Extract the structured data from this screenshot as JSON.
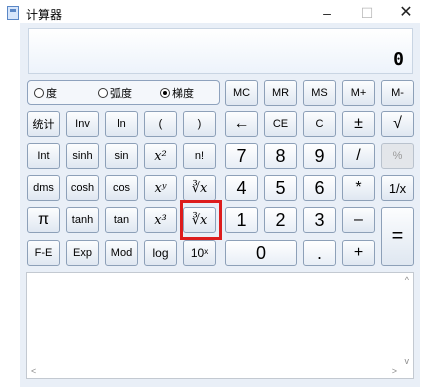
{
  "window": {
    "title": "计算器",
    "minimize": "–",
    "maximize": "☐",
    "close": "✕"
  },
  "display": {
    "value": "0"
  },
  "angle_mode": {
    "options": [
      "度",
      "弧度",
      "梯度"
    ],
    "selected": "梯度"
  },
  "memory": [
    "MC",
    "MR",
    "MS",
    "M+",
    "M-"
  ],
  "rows": {
    "r1": [
      "统计",
      "Inv",
      "ln",
      "(",
      ")",
      "←",
      "CE",
      "C",
      "±",
      "√"
    ],
    "r2": [
      "Int",
      "sinh",
      "sin",
      "x²",
      "n!",
      "7",
      "8",
      "9",
      "/",
      "%"
    ],
    "r3": [
      "dms",
      "cosh",
      "cos",
      "xʸ",
      "∛x",
      "4",
      "5",
      "6",
      "*",
      "1/x"
    ],
    "r4": [
      "π",
      "tanh",
      "tan",
      "x³",
      "∛x",
      "1",
      "2",
      "3",
      "–",
      "="
    ],
    "r5": [
      "F-E",
      "Exp",
      "Mod",
      "log",
      "10ˣ",
      "0",
      ".",
      "+"
    ]
  },
  "highlight": {
    "target": "r4.4",
    "color": "#dd1c1c"
  },
  "history": {
    "scroll": {
      "up": "^",
      "down": "v",
      "left": "<",
      "right": ">"
    }
  }
}
